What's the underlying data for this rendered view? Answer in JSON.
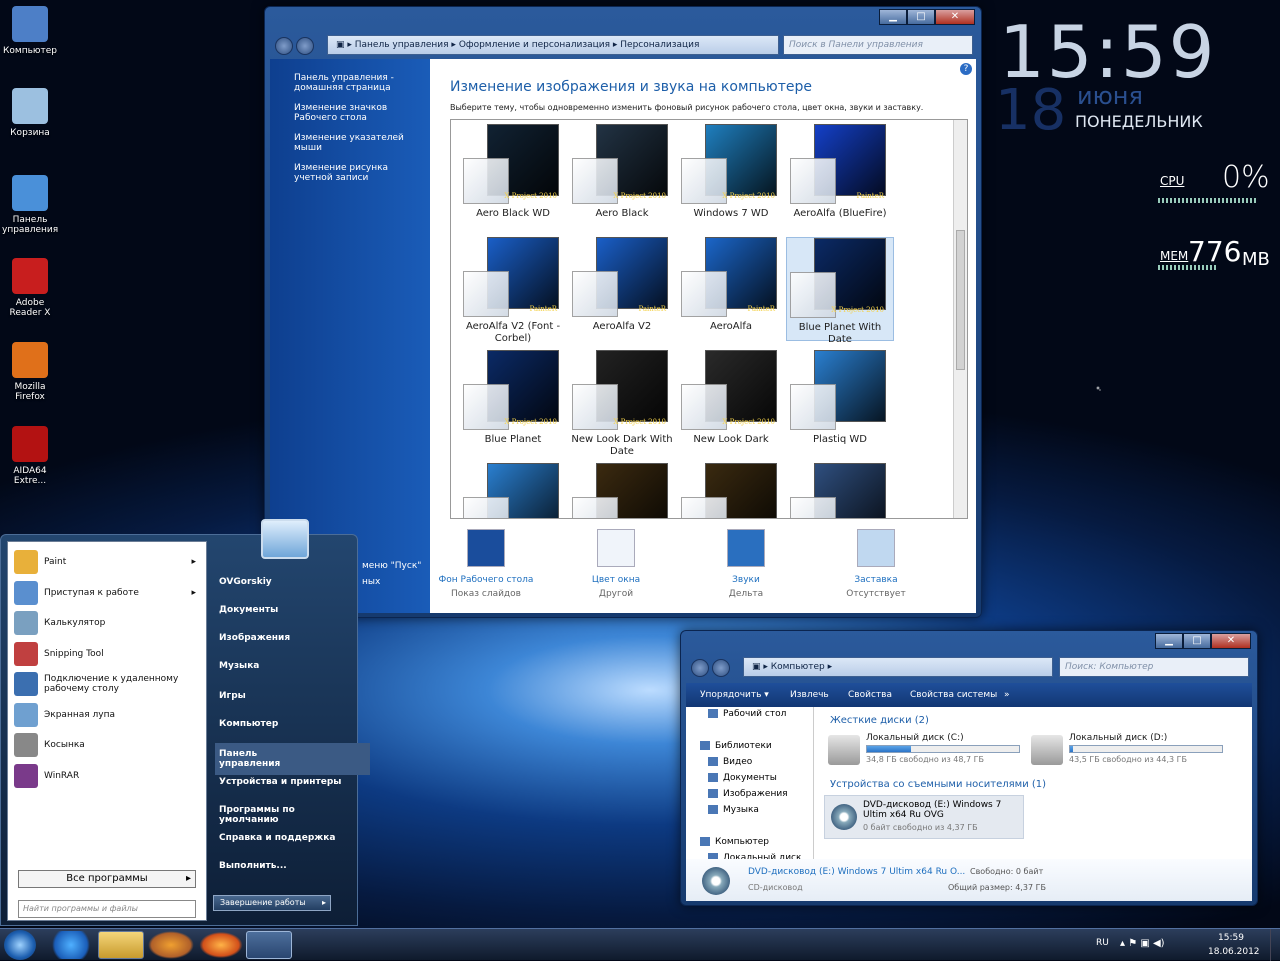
{
  "desktop": {
    "icons": [
      {
        "label": "Компьютер",
        "color": "#4d7fc7"
      },
      {
        "label": "Корзина",
        "color": "#9cc0e0"
      },
      {
        "label": "Панель управления",
        "color": "#4a90d9"
      },
      {
        "label": "Adobe Reader X",
        "color": "#c81e1e"
      },
      {
        "label": "Mozilla Firefox",
        "color": "#e0701a"
      },
      {
        "label": "AIDA64 Extre...",
        "color": "#b31212"
      }
    ]
  },
  "clock": {
    "time": "15:59",
    "day": "18",
    "month": "июня",
    "weekday": "ПОНЕДЕЛЬНИК"
  },
  "meters": {
    "cpu_label": "CPU",
    "cpu_value": "0%",
    "mem_label": "MEM",
    "mem_value": "776",
    "mem_unit": "MB"
  },
  "cp_window": {
    "breadcrumb": [
      "Панель управления",
      "Оформление и персонализация",
      "Персонализация"
    ],
    "search_placeholder": "Поиск в Панели управления",
    "left_links": [
      "Панель управления - домашняя страница",
      "Изменение значков Рабочего стола",
      "Изменение указателей мыши",
      "Изменение рисунка учетной записи"
    ],
    "left_bottom": [
      "меню \"Пуск\"",
      "ных"
    ],
    "title": "Изменение изображения и звука на компьютере",
    "subtitle": "Выберите тему, чтобы одновременно изменить фоновый рисунок рабочего стола, цвет окна, звуки и заставку.",
    "themes": [
      {
        "name": "Aero Black WD",
        "tag": "X Project 2010",
        "bg": "#123"
      },
      {
        "name": "Aero Black",
        "tag": "X Project 2010",
        "bg": "#234"
      },
      {
        "name": "Windows 7 WD",
        "tag": "X Project 2010",
        "bg": "#1f7fbf"
      },
      {
        "name": "AeroAlfa (BlueFire)",
        "tag": "PainteR",
        "bg": "#1440c8"
      },
      {
        "name": "AeroAlfa V2 (Font - Corbel)",
        "tag": "PainteR",
        "bg": "#1a5fc8"
      },
      {
        "name": "AeroAlfa V2",
        "tag": "PainteR",
        "bg": "#1a5fc8"
      },
      {
        "name": "AeroAlfa",
        "tag": "PainteR",
        "bg": "#1b66c9"
      },
      {
        "name": "Blue Planet With Date",
        "tag": "X Project 2010",
        "bg": "#0b2a66"
      },
      {
        "name": "Blue Planet",
        "tag": "X Project 2010",
        "bg": "#0b2a66"
      },
      {
        "name": "New Look Dark With Date",
        "tag": "X Project 2010",
        "bg": "#222"
      },
      {
        "name": "New Look Dark",
        "tag": "X Project 2010",
        "bg": "#2a2a2a"
      },
      {
        "name": "Plastiq WD",
        "tag": "",
        "bg": "#2a7fd0"
      },
      {
        "name": "",
        "tag": "",
        "bg": "#2a7fd0"
      },
      {
        "name": "",
        "tag": "",
        "bg": "#3b2a10"
      },
      {
        "name": "",
        "tag": "",
        "bg": "#3a2a10"
      },
      {
        "name": "",
        "tag": "",
        "bg": "#2f4f7f"
      }
    ],
    "bottom": [
      {
        "t1": "Фон Рабочего стола",
        "t2": "Показ слайдов"
      },
      {
        "t1": "Цвет окна",
        "t2": "Другой"
      },
      {
        "t1": "Звуки",
        "t2": "Дельта"
      },
      {
        "t1": "Заставка",
        "t2": "Отсутствует"
      }
    ]
  },
  "start_menu": {
    "left_items": [
      {
        "label": "Paint",
        "arrow": "▸",
        "color": "#e8b03a"
      },
      {
        "label": "Приступая к работе",
        "arrow": "▸",
        "color": "#5a8fcf"
      },
      {
        "label": "Калькулятор",
        "arrow": "",
        "color": "#7aa0c0"
      },
      {
        "label": "Snipping Tool",
        "arrow": "",
        "color": "#c04040"
      },
      {
        "label": "Подключение к удаленному рабочему столу",
        "arrow": "",
        "color": "#3b6fb0"
      },
      {
        "label": "Экранная лупа",
        "arrow": "",
        "color": "#6fa0d0"
      },
      {
        "label": "Косынка",
        "arrow": "",
        "color": "#888"
      },
      {
        "label": "WinRAR",
        "arrow": "",
        "color": "#7a3a8a"
      }
    ],
    "all_programs": "Все программы",
    "search_placeholder": "Найти программы и файлы",
    "right_items": [
      "OVGorskiy",
      "Документы",
      "Изображения",
      "Музыка",
      "Игры",
      "Компьютер",
      "Панель управления",
      "Устройства и принтеры",
      "Программы по умолчанию",
      "Справка и поддержка",
      "Выполнить..."
    ],
    "shutdown": "Завершение работы"
  },
  "explorer": {
    "breadcrumb": "Компьютер",
    "search_placeholder": "Поиск: Компьютер",
    "toolbar": [
      "Упорядочить ▾",
      "Извлечь",
      "Свойства",
      "Свойства системы",
      "»"
    ],
    "nav": [
      "Рабочий стол",
      "Библиотеки",
      "Видео",
      "Документы",
      "Изображения",
      "Музыка",
      "Компьютер",
      "Локальный диск"
    ],
    "group1": "Жесткие диски (2)",
    "drives": [
      {
        "name": "Локальный диск (C:)",
        "free": "34,8 ГБ свободно из 48,7 ГБ",
        "fill": 0.29
      },
      {
        "name": "Локальный диск (D:)",
        "free": "43,5 ГБ свободно из 44,3 ГБ",
        "fill": 0.02
      }
    ],
    "group2": "Устройства со съемными носителями (1)",
    "dvd": {
      "name": "DVD-дисковод (E:) Windows 7 Ultim x64 Ru OVG",
      "free": "0 байт свободно из 4,37 ГБ"
    },
    "status": {
      "name": "DVD-дисковод (E:) Windows 7 Ultim x64 Ru O...",
      "type": "CD-дисковод",
      "free_label": "Свободно: 0 байт",
      "size_label": "Общий размер: 4,37 ГБ"
    }
  },
  "taskbar": {
    "lang": "RU",
    "time": "15:59",
    "date": "18.06.2012"
  }
}
